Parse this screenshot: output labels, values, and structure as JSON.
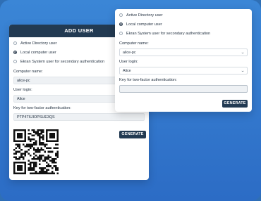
{
  "back_card": {
    "title": "ADD USER",
    "options": [
      {
        "label": "Active Directory user",
        "selected": false
      },
      {
        "label": "Local computer user",
        "selected": true
      },
      {
        "label": "Ekran System user for secondary authentication",
        "selected": false
      }
    ],
    "computer_name_label": "Computer name:",
    "computer_name_value": "alice-pc",
    "user_login_label": "User login:",
    "user_login_value": "Alice",
    "key_label": "Key for two-factor authentication:",
    "key_value": "PTP4T6JIOPSUE3QS",
    "generate_label": "GENERATE"
  },
  "front_card": {
    "options": [
      {
        "label": "Active Directory user",
        "selected": false
      },
      {
        "label": "Local computer user",
        "selected": true
      },
      {
        "label": "Ekran System user for secondary authentication",
        "selected": false
      }
    ],
    "computer_name_label": "Computer name:",
    "computer_name_value": "alice-pc",
    "user_login_label": "User login:",
    "user_login_value": "Alice",
    "key_label": "Key for two-factor authentication:",
    "key_value": "",
    "generate_label": "GENERATE"
  },
  "icons": {
    "dropdown": "chevron-down-icon",
    "qr": "qr-code-icon"
  },
  "colors": {
    "background": "#2f7bd3",
    "header": "#223a52",
    "button": "#223a52"
  }
}
